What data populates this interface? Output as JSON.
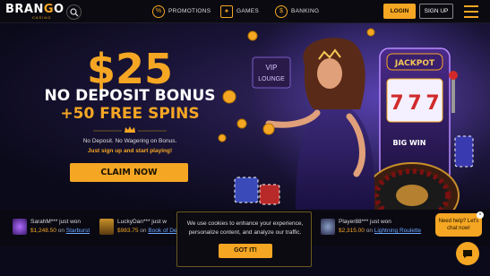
{
  "brand": {
    "name_a": "BRAN",
    "name_o": "G",
    "name_b": "O",
    "tagline": "CASINO"
  },
  "nav": [
    {
      "label": "PROMOTIONS",
      "icon": "percent-icon"
    },
    {
      "label": "GAMES",
      "icon": "cards-icon"
    },
    {
      "label": "BANKING",
      "icon": "dollar-icon"
    }
  ],
  "header": {
    "login": "LOGIN",
    "signup": "SIGN UP"
  },
  "hero": {
    "amount": "$25",
    "bonus": "NO DEPOSIT BONUS",
    "spins": "+50 FREE SPINS",
    "terms": "No Deposit. No Wagering on Bonus.",
    "cta_text": "Just sign up and start playing!",
    "claim": "CLAIM NOW",
    "sign_vip": "VIP",
    "sign_lounge": "LOUNGE",
    "sign_jackpot": "JACKPOT",
    "sign_bigwin": "BIG WIN",
    "reels": [
      "7",
      "7",
      "7"
    ]
  },
  "winners": [
    {
      "who": "SarahM*** just won",
      "amount": "$1,248.50",
      "on": " on ",
      "game": "Starburst"
    },
    {
      "who": "LuckyDan*** just w",
      "amount": "$983.75",
      "on": " on ",
      "game": "Book of De"
    },
    {
      "who": "Player88*** just won",
      "amount": "$2,315.00",
      "on": " on ",
      "game": "Lightning Roulette"
    }
  ],
  "cookie": {
    "line1": "We use cookies to enhance your experience,",
    "line2": "personalize content, and analyze our traffic.",
    "ok": "GOT IT!"
  },
  "help": {
    "line1": "Need help? Let's",
    "line2": "chat now!",
    "close": "×"
  },
  "colors": {
    "accent": "#f5a623",
    "background": "#0b0a1a",
    "link": "#6aa7ff"
  }
}
